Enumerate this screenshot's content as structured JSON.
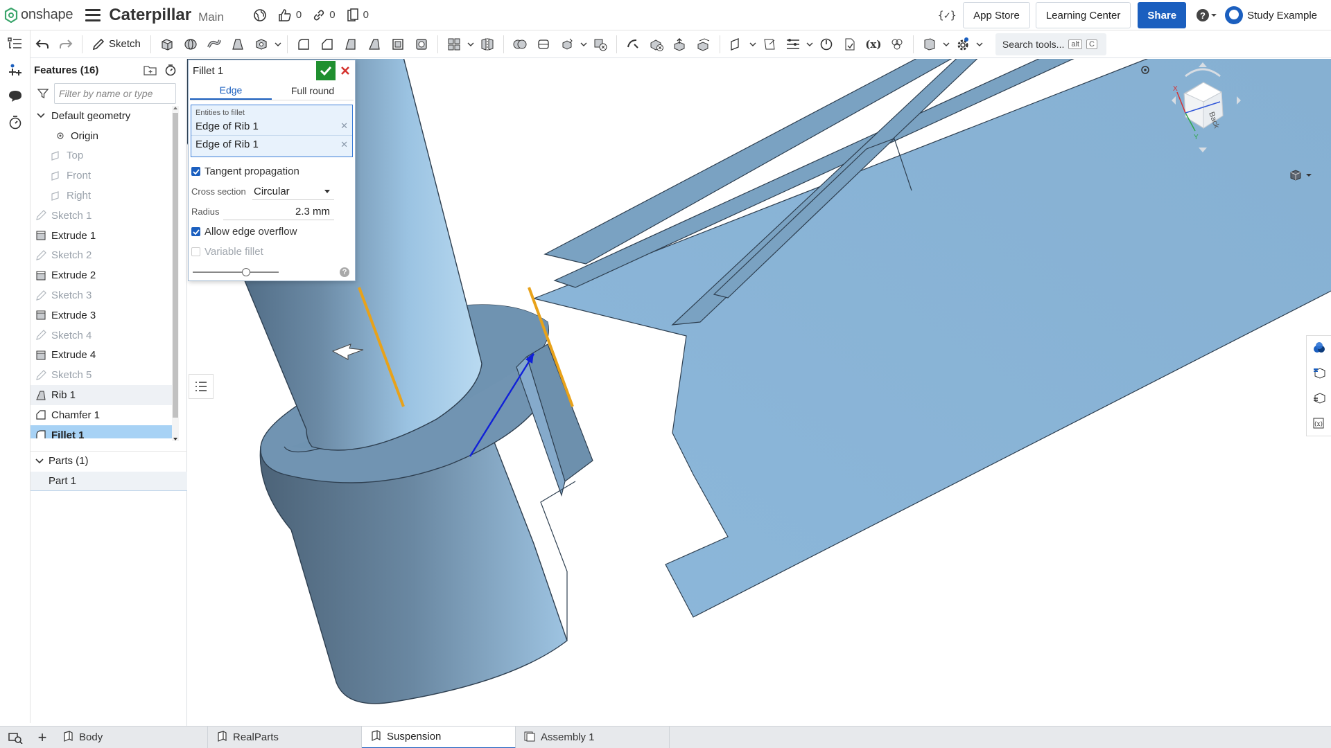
{
  "app": {
    "logo_text": "onshape",
    "document_title": "Caterpillar",
    "branch": "Main"
  },
  "top_stats": {
    "likes": "0",
    "links": "0",
    "copies": "0"
  },
  "top_right": {
    "app_store": "App Store",
    "learning_center": "Learning Center",
    "share": "Share",
    "user": "Study Example"
  },
  "toolbar": {
    "sketch_label": "Sketch",
    "search_placeholder": "Search tools...",
    "search_kbd_alt": "alt",
    "search_kbd_key": "C"
  },
  "feature_panel": {
    "title": "Features (16)",
    "filter_placeholder": "Filter by name or type",
    "tree": [
      {
        "label": "Default geometry",
        "kind": "group"
      },
      {
        "label": "Origin",
        "kind": "origin"
      },
      {
        "label": "Top",
        "kind": "plane"
      },
      {
        "label": "Front",
        "kind": "plane"
      },
      {
        "label": "Right",
        "kind": "plane"
      },
      {
        "label": "Sketch 1",
        "kind": "sketch"
      },
      {
        "label": "Extrude 1",
        "kind": "extrude"
      },
      {
        "label": "Sketch 2",
        "kind": "sketch"
      },
      {
        "label": "Extrude 2",
        "kind": "extrude"
      },
      {
        "label": "Sketch 3",
        "kind": "sketch"
      },
      {
        "label": "Extrude 3",
        "kind": "extrude"
      },
      {
        "label": "Sketch 4",
        "kind": "sketch"
      },
      {
        "label": "Extrude 4",
        "kind": "extrude"
      },
      {
        "label": "Sketch 5",
        "kind": "sketch"
      },
      {
        "label": "Rib 1",
        "kind": "rib"
      },
      {
        "label": "Chamfer 1",
        "kind": "chamfer"
      },
      {
        "label": "Fillet 1",
        "kind": "fillet"
      }
    ],
    "parts_header": "Parts (1)",
    "parts": [
      "Part 1"
    ]
  },
  "dialog": {
    "title": "Fillet 1",
    "tabs": [
      "Edge",
      "Full round"
    ],
    "entities_label": "Entities to fillet",
    "entities": [
      "Edge of Rib 1",
      "Edge of Rib 1"
    ],
    "tangent_propagation": "Tangent propagation",
    "cross_section_label": "Cross section",
    "cross_section_value": "Circular",
    "radius_label": "Radius",
    "radius_value": "2.3 mm",
    "allow_edge_overflow": "Allow edge overflow",
    "variable_fillet": "Variable fillet",
    "slider_position": 0.62
  },
  "viewcube": {
    "face_label": "Back",
    "axes": {
      "x": "X",
      "y": "Y"
    }
  },
  "bottom_tabs": [
    "Body",
    "RealParts",
    "Suspension",
    "Assembly 1"
  ],
  "active_bottom_tab": "Suspension",
  "colors": {
    "accent": "#1b5fbf",
    "model": "#8fb5d3",
    "model_dark": "#5a7a94",
    "selected_edge": "#e8a21a",
    "ok_green": "#1f8f2f"
  }
}
